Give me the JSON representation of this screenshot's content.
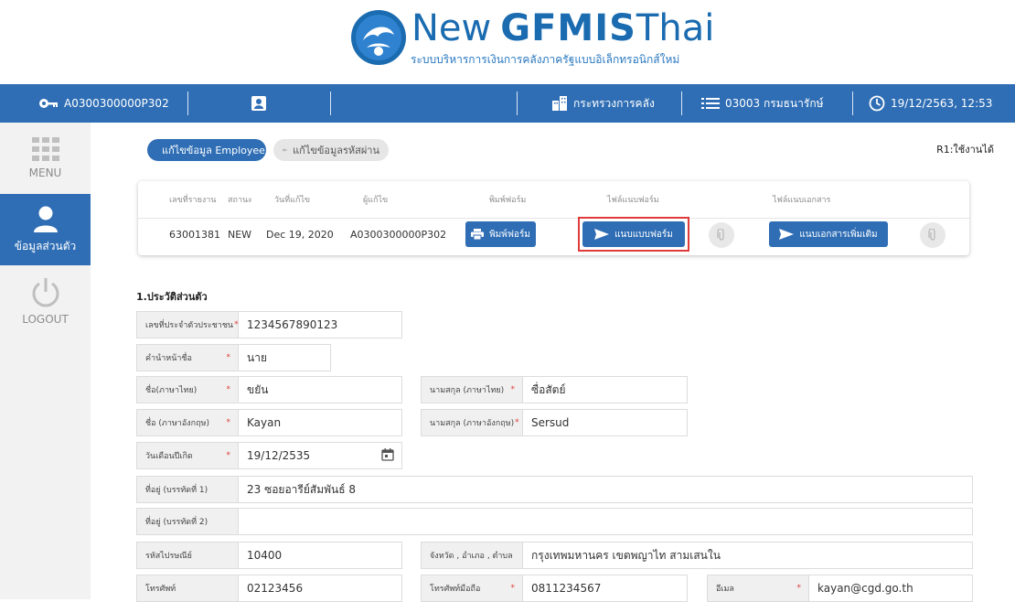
{
  "logo": {
    "word1": "New",
    "word2": "GFMIS",
    "word3": "Thai",
    "subtitle": "ระบบบริหารการเงินการคลังภาครัฐแบบอิเล็กทรอนิกส์ใหม่"
  },
  "topbar": {
    "user_code": "A0300300000P302",
    "ministry": "กระทรวงการคลัง",
    "department": "03003 กรมธนารักษ์",
    "datetime": "19/12/2563, 12:53"
  },
  "sidebar": {
    "items": [
      {
        "label": "MENU",
        "icon": "grid-icon"
      },
      {
        "label": "ข้อมูลส่วนตัว",
        "icon": "person-icon"
      },
      {
        "label": "LOGOUT",
        "icon": "power-icon"
      }
    ]
  },
  "tabs": {
    "edit_employee": "แก้ไขข้อมูล Employee",
    "edit_password": "แก้ไขข้อมูลรหัสผ่าน"
  },
  "status_right": "R1:ใช้งานได้",
  "doc": {
    "headers": {
      "report_no": "เลขที่รายงาน",
      "status": "สถานะ",
      "edit_date": "วันที่แก้ไข",
      "editor": "ผู้แก้ไข",
      "print_form": "พิมพ์ฟอร์ม",
      "attach_form": "ไฟล์แนบฟอร์ม",
      "attach_doc": "ไฟล์แนบเอกสาร"
    },
    "values": {
      "report_no": "63001381",
      "status": "NEW",
      "edit_date": "Dec 19, 2020",
      "editor": "A0300300000P302"
    },
    "buttons": {
      "print": "พิมพ์ฟอร์ม",
      "attach_form": "แนบแบบฟอร์ม",
      "attach_more": "แนบเอกสารเพิ่มเติม"
    }
  },
  "section": {
    "title": "1.ประวัติส่วนตัว"
  },
  "form": {
    "national_id": {
      "label": "เลขที่ประจำตัวประชาชน",
      "value": "1234567890123"
    },
    "prefix": {
      "label": "คำนำหน้าชื่อ",
      "value": "นาย"
    },
    "first_name_th": {
      "label": "ชื่อ(ภาษาไทย)",
      "value": "ขยัน"
    },
    "last_name_th": {
      "label": "นามสกุล (ภาษาไทย)",
      "value": "ซื่อสัตย์"
    },
    "first_name_en": {
      "label": "ชื่อ (ภาษาอังกฤษ)",
      "value": "Kayan"
    },
    "last_name_en": {
      "label": "นามสกุล (ภาษาอังกฤษ)",
      "value": "Sersud"
    },
    "birth_date": {
      "label": "วันเดือนปีเกิด",
      "value": "19/12/2535"
    },
    "address1": {
      "label": "ที่อยู่ (บรรทัดที่ 1)",
      "value": "23 ซอยอารีย์สัมพันธ์ 8"
    },
    "address2": {
      "label": "ที่อยู่ (บรรทัดที่ 2)",
      "value": ""
    },
    "postal_code": {
      "label": "รหัสไปรษณีย์",
      "value": "10400"
    },
    "province": {
      "label": "จังหวัด , อำเภอ , ตำบล",
      "value": "กรุงเทพมหานคร เขตพญาไท สามเสนใน"
    },
    "phone": {
      "label": "โทรศัพท์",
      "value": "02123456"
    },
    "mobile": {
      "label": "โทรศัพท์มือถือ",
      "value": "0811234567"
    },
    "email": {
      "label": "อีเมล",
      "value": "kayan@cgd.go.th"
    }
  },
  "colors": {
    "primary": "#2f6eb5",
    "highlight": "#e03a3a",
    "required": "#e03a3a"
  }
}
